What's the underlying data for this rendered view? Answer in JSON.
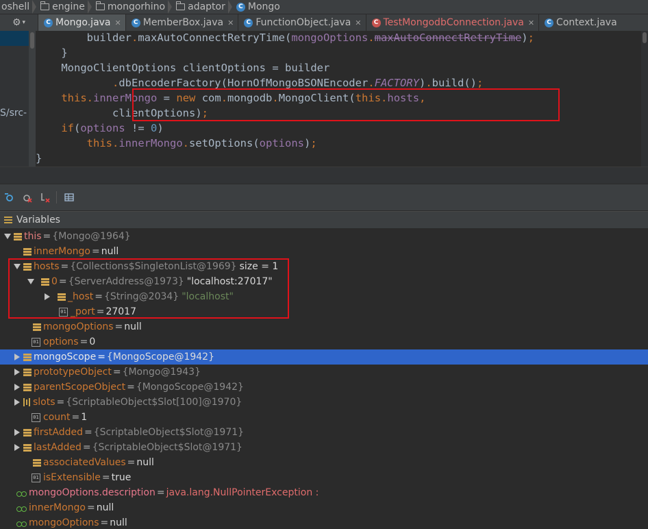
{
  "breadcrumb": {
    "items": [
      {
        "label": "oshell",
        "icon": "none"
      },
      {
        "label": "engine",
        "icon": "folder-icon"
      },
      {
        "label": "mongorhino",
        "icon": "folder-icon"
      },
      {
        "label": "adaptor",
        "icon": "folder-icon"
      },
      {
        "label": "Mongo",
        "icon": "class-icon"
      }
    ]
  },
  "tabs": [
    {
      "label": "Mongo.java",
      "active": true
    },
    {
      "label": "MemberBox.java",
      "active": false
    },
    {
      "label": "FunctionObject.java",
      "active": false
    },
    {
      "label": "TestMongodbConnection.java",
      "active": false
    },
    {
      "label": "Context.java",
      "active": false
    }
  ],
  "editor": {
    "gutter_text": "S/src-",
    "lines": [
      "        builder.maxAutoConnectRetryTime(mongoOptions.maxAutoConnectRetryTime);",
      "    }",
      "    MongoClientOptions clientOptions = builder",
      "            .dbEncoderFactory(HornOfMongoBSONEncoder.FACTORY).build();",
      "    this.innerMongo = new com.mongodb.MongoClient(this.hosts,",
      "            clientOptions);",
      "    if(options != 0)",
      "        this.innerMongo.setOptions(options);",
      "}"
    ]
  },
  "variables_panel": {
    "title": "Variables",
    "rows": [
      {
        "name": "this",
        "eq": " = ",
        "type": "{Mongo@1964}"
      },
      {
        "name": "innerMongo",
        "eq": " = ",
        "value": "null"
      },
      {
        "name": "hosts",
        "eq": " = ",
        "type": "{Collections$SingletonList@1969}",
        "value": "size = 1"
      },
      {
        "name": "0",
        "eq": " = ",
        "type": "{ServerAddress@1973}",
        "value": "\"localhost:27017\""
      },
      {
        "name": "_host",
        "eq": " = ",
        "type": "{String@2034}",
        "value": "\"localhost\""
      },
      {
        "name": "_port",
        "eq": " = ",
        "value": "27017"
      },
      {
        "name": "mongoOptions",
        "eq": " = ",
        "value": "null"
      },
      {
        "name": "options",
        "eq": " = ",
        "value": "0"
      },
      {
        "name": "mongoScope",
        "eq": " = ",
        "type": "{MongoScope@1942}"
      },
      {
        "name": "prototypeObject",
        "eq": " = ",
        "type": "{Mongo@1943}"
      },
      {
        "name": "parentScopeObject",
        "eq": " = ",
        "type": "{MongoScope@1942}"
      },
      {
        "name": "slots",
        "eq": " = ",
        "type": "{ScriptableObject$Slot[100]@1970}"
      },
      {
        "name": "count",
        "eq": " = ",
        "value": "1"
      },
      {
        "name": "firstAdded",
        "eq": " = ",
        "type": "{ScriptableObject$Slot@1971}"
      },
      {
        "name": "lastAdded",
        "eq": " = ",
        "type": "{ScriptableObject$Slot@1971}"
      },
      {
        "name": "associatedValues",
        "eq": " = ",
        "value": "null"
      },
      {
        "name": "isExtensible",
        "eq": " = ",
        "value": "true"
      }
    ],
    "watches": [
      {
        "name": "mongoOptions.description",
        "eq": " = ",
        "value": "java.lang.NullPointerException :"
      },
      {
        "name": "innerMongo",
        "eq": " = ",
        "value": "null"
      },
      {
        "name": "mongoOptions",
        "eq": " = ",
        "value": "null"
      }
    ]
  },
  "colors": {
    "selection": "#2f65ca",
    "highlight_box": "#e0121a",
    "keyword": "#cc7832",
    "field": "#9876aa",
    "number": "#6897bb",
    "string": "#6a8759"
  }
}
